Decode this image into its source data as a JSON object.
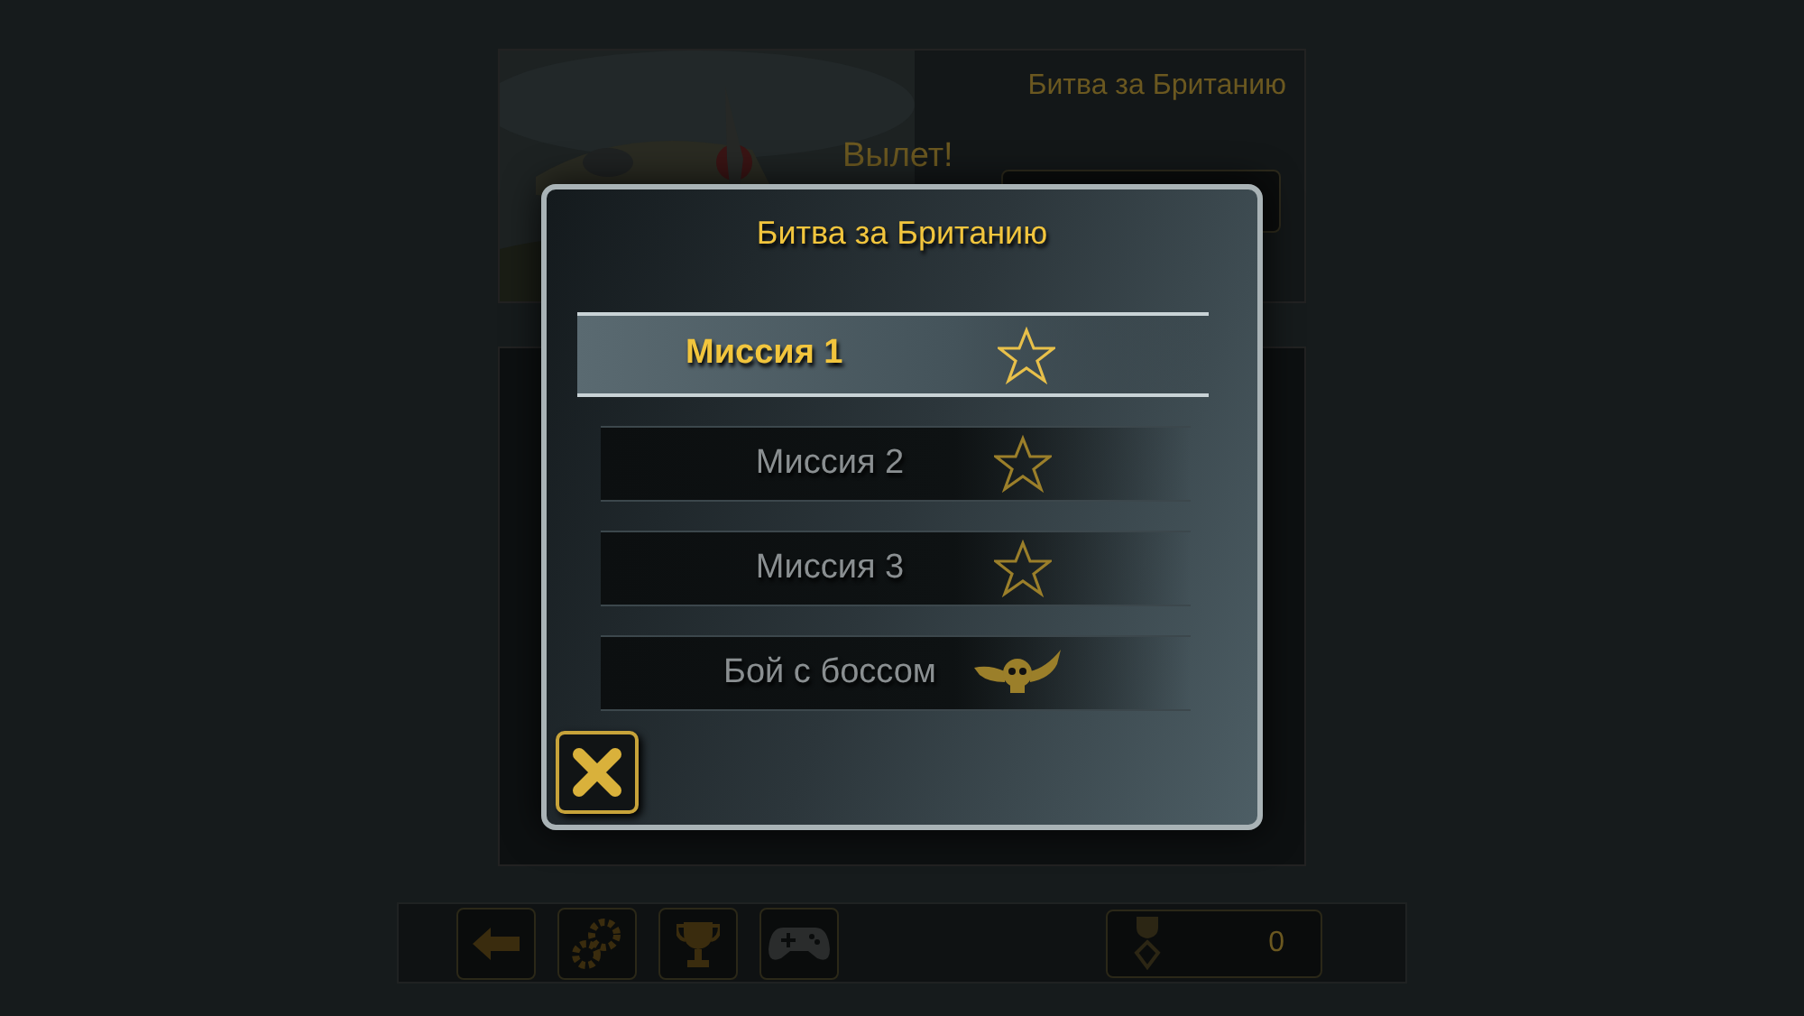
{
  "backdrop": {
    "campaign_title": "Битва за Британию",
    "launch_label": "Вылет!",
    "score": "0"
  },
  "dialog": {
    "title": "Битва за Британию",
    "missions": [
      {
        "label": "Миссия 1",
        "selected": true,
        "kind": "star"
      },
      {
        "label": "Миссия 2",
        "selected": false,
        "kind": "star"
      },
      {
        "label": "Миссия 3",
        "selected": false,
        "kind": "star"
      },
      {
        "label": "Бой с боссом",
        "selected": false,
        "kind": "boss"
      }
    ]
  }
}
